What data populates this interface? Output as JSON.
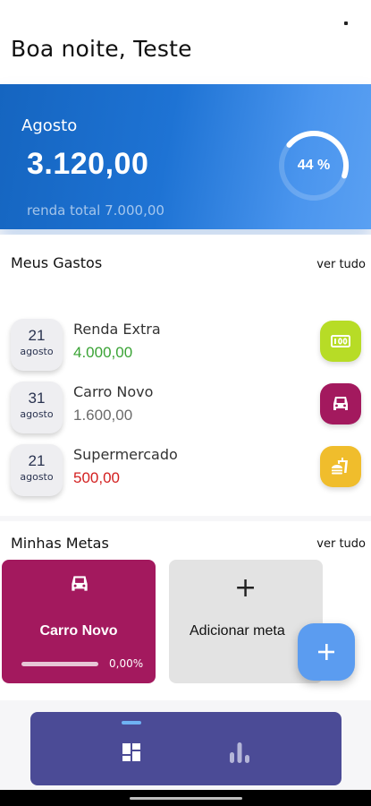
{
  "header": {
    "greeting": "Boa noite, Teste"
  },
  "summary": {
    "month": "Agosto",
    "balance": "3.120,00",
    "total_income_text": "renda total 7.000,00",
    "progress_label": "44 %",
    "progress_value": 0.44
  },
  "expenses": {
    "title": "Meus Gastos",
    "see_all": "ver tudo",
    "items": [
      {
        "day": "21",
        "month": "agosto",
        "name": "Renda Extra",
        "amount": "4.000,00",
        "amount_color": "#3aa335",
        "icon": "cash-icon",
        "icon_bg": "#b7dc26"
      },
      {
        "day": "31",
        "month": "agosto",
        "name": "Carro Novo",
        "amount": "1.600,00",
        "amount_color": "#6b6b6b",
        "icon": "car-icon",
        "icon_bg": "#a3195e"
      },
      {
        "day": "21",
        "month": "agosto",
        "name": "Supermercado",
        "amount": "500,00",
        "amount_color": "#d32020",
        "icon": "fastfood-icon",
        "icon_bg": "#f0bd2c"
      }
    ]
  },
  "goals": {
    "title": "Minhas Metas",
    "see_all": "ver tudo",
    "items": [
      {
        "name": "Carro Novo",
        "percent_text": "0,00%",
        "progress": 0,
        "icon": "car-icon",
        "color": "#a3195e"
      }
    ],
    "add_label": "Adicionar meta",
    "add_symbol": "+"
  },
  "fab": {
    "symbol": "+",
    "color": "#5b9cf0"
  },
  "nav": {
    "items": [
      {
        "icon": "dashboard-icon",
        "active": true
      },
      {
        "icon": "bar-chart-icon",
        "active": false
      }
    ]
  },
  "colors": {
    "card_gradient_start": "#1565c0",
    "card_gradient_end": "#5aa0f2",
    "nav_background": "#4b4b96",
    "nav_indicator": "#6fb2f4"
  }
}
